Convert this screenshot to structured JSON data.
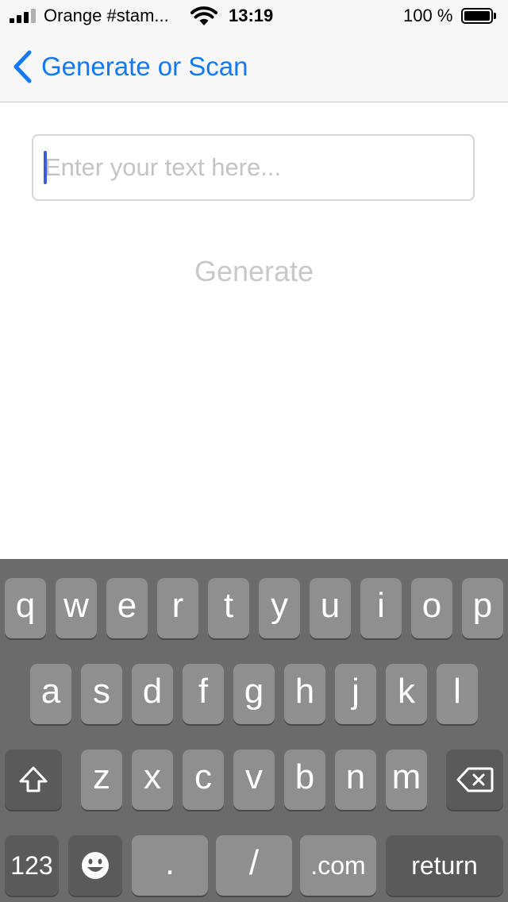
{
  "status_bar": {
    "carrier": "Orange #stam...",
    "time": "13:19",
    "battery_percent": "100 %",
    "battery_level": 1.0,
    "signal_bars": 4,
    "signal_bars_filled": 3
  },
  "nav": {
    "back_label": "Generate or Scan",
    "accent_color": "#1479f5"
  },
  "form": {
    "text_input_value": "",
    "text_input_placeholder": "Enter your text here...",
    "generate_label": "Generate"
  },
  "keyboard": {
    "row1": [
      "q",
      "w",
      "e",
      "r",
      "t",
      "y",
      "u",
      "i",
      "o",
      "p"
    ],
    "row2": [
      "a",
      "s",
      "d",
      "f",
      "g",
      "h",
      "j",
      "k",
      "l"
    ],
    "row3": [
      "z",
      "x",
      "c",
      "v",
      "b",
      "n",
      "m"
    ],
    "shift_icon": "shift-icon",
    "backspace_icon": "backspace-icon",
    "numbers_label": "123",
    "emoji_icon": "emoji-icon",
    "period_label": ".",
    "slash_label": "/",
    "dotcom_label": ".com",
    "return_label": "return"
  }
}
